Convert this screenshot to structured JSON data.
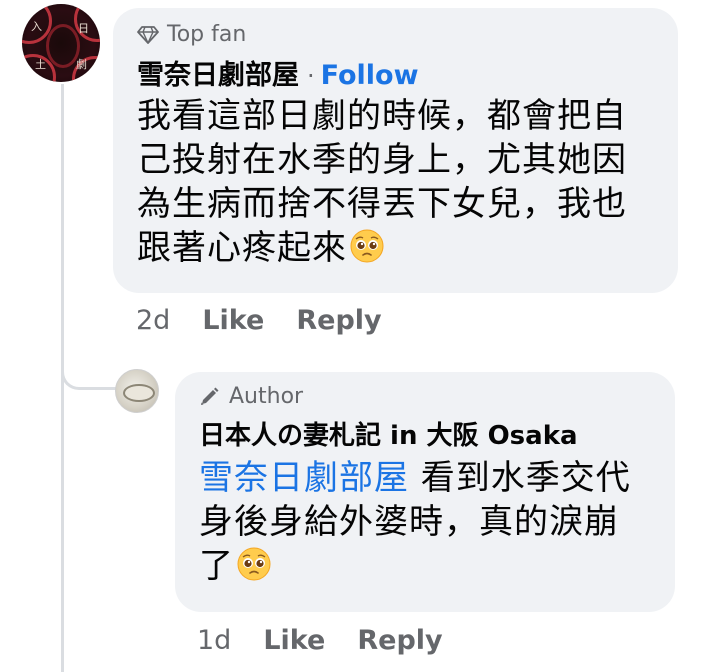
{
  "comments": [
    {
      "badge": "Top fan",
      "author": "雪奈日劇部屋",
      "separator": "·",
      "follow_label": "Follow",
      "text": "我看這部日劇的時候，都會把自己投射在水季的身上，尤其她因為生病而捨不得丟下女兒，我也跟著心疼起來",
      "emoji": "pleading-face-emoji",
      "time": "2d",
      "like_label": "Like",
      "reply_label": "Reply",
      "avatar_chars": [
        "入",
        "日",
        "土",
        "劇"
      ]
    },
    {
      "badge": "Author",
      "author": "日本人の妻札記 in 大阪 Osaka",
      "mention": "雪奈日劇部屋",
      "text": " 看到水季交代身後身給外婆時，真的淚崩了",
      "emoji": "pleading-face-emoji",
      "time": "1d",
      "like_label": "Like",
      "reply_label": "Reply"
    }
  ],
  "colors": {
    "link": "#1b74e4",
    "bubble_bg": "#f0f2f5",
    "secondary_text": "#65676b",
    "thread_line": "#dadde1"
  }
}
